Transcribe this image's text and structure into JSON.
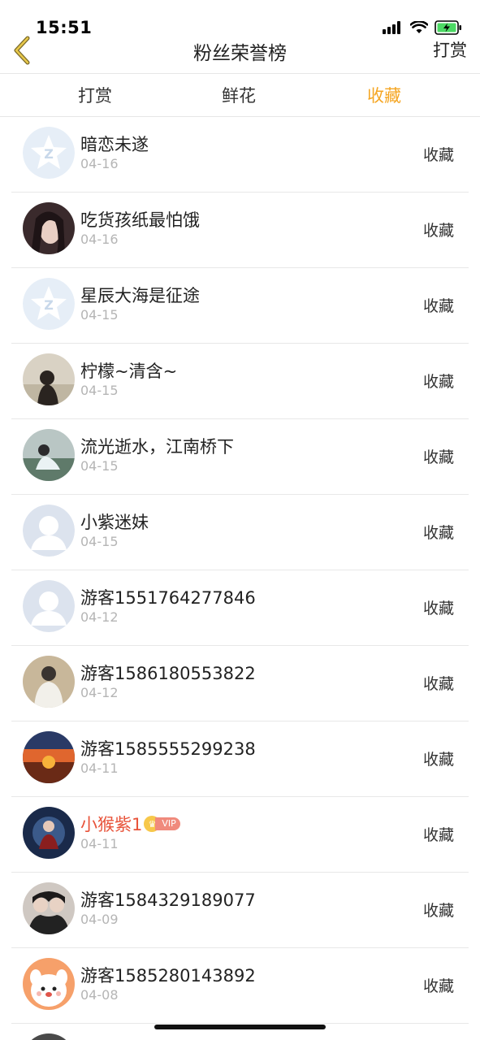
{
  "status_bar": {
    "time": "15:51"
  },
  "nav": {
    "title": "粉丝荣誉榜",
    "right_label": "打赏"
  },
  "tabs": [
    {
      "label": "打赏",
      "active": false
    },
    {
      "label": "鲜花",
      "active": false
    },
    {
      "label": "收藏",
      "active": true
    }
  ],
  "colors": {
    "accent": "#f5a623",
    "vip_name": "#e8533a",
    "date": "#b5b5b5"
  },
  "rows": [
    {
      "name": "暗恋未遂",
      "date": "04-16",
      "action": "收藏",
      "avatar": "qq-default-icon"
    },
    {
      "name": "吃货孩纸最怕饿",
      "date": "04-16",
      "action": "收藏",
      "avatar": "photo"
    },
    {
      "name": "星辰大海是征途",
      "date": "04-15",
      "action": "收藏",
      "avatar": "qq-default-icon"
    },
    {
      "name": "柠檬~清含~",
      "date": "04-15",
      "action": "收藏",
      "avatar": "photo"
    },
    {
      "name": "流光逝水，江南桥下",
      "date": "04-15",
      "action": "收藏",
      "avatar": "photo"
    },
    {
      "name": "小紫迷妹",
      "date": "04-15",
      "action": "收藏",
      "avatar": "person-placeholder-icon"
    },
    {
      "name": "游客1551764277846",
      "date": "04-12",
      "action": "收藏",
      "avatar": "person-placeholder-icon"
    },
    {
      "name": "游客1586180553822",
      "date": "04-12",
      "action": "收藏",
      "avatar": "photo"
    },
    {
      "name": "游客1585555299238",
      "date": "04-11",
      "action": "收藏",
      "avatar": "photo"
    },
    {
      "name": "小猴紫1",
      "date": "04-11",
      "action": "收藏",
      "avatar": "photo",
      "vip": "VIP"
    },
    {
      "name": "游客1584329189077",
      "date": "04-09",
      "action": "收藏",
      "avatar": "photo"
    },
    {
      "name": "游客1585280143892",
      "date": "04-08",
      "action": "收藏",
      "avatar": "cartoon-dog-icon"
    }
  ]
}
